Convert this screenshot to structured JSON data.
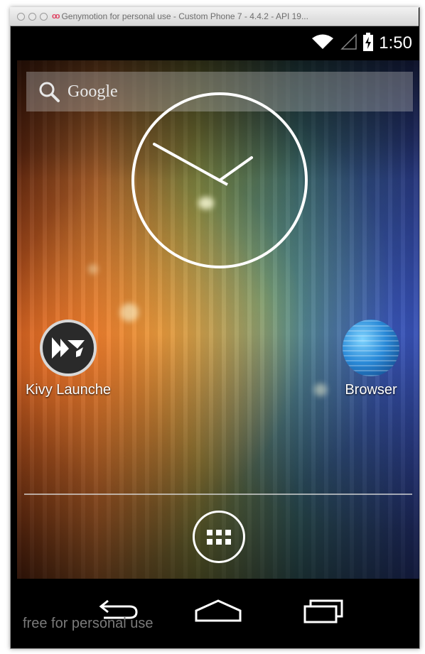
{
  "window": {
    "title": "Genymotion for personal use - Custom Phone 7 - 4.4.2 - API 19...",
    "logo_text": "oo"
  },
  "statusbar": {
    "time": "1:50",
    "icons": [
      "wifi-icon",
      "signal-icon",
      "battery-charging-icon"
    ]
  },
  "search": {
    "label": "Google",
    "icon": "search-icon"
  },
  "widget": {
    "type": "analog-clock",
    "hour_hand": "1",
    "minute_hand": "50"
  },
  "apps": [
    {
      "label": "Kivy Launche",
      "icon": "kivy-icon"
    },
    {
      "label": "Browser",
      "icon": "globe-icon"
    }
  ],
  "dock": {
    "all_apps_icon": "app-drawer-icon"
  },
  "navbar": {
    "buttons": [
      "back-icon",
      "home-icon",
      "recents-icon"
    ]
  },
  "watermark": "free for personal use",
  "colors": {
    "text": "#ffffff",
    "statusbar_bg": "#000000",
    "title_text": "#6e6e6e",
    "logo": "#e04060"
  }
}
